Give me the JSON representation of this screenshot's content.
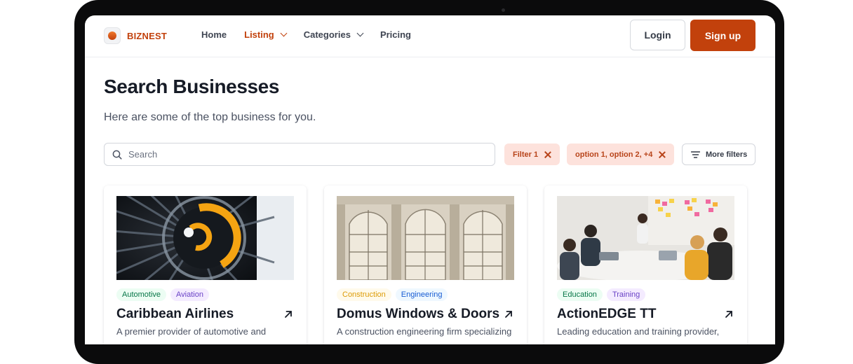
{
  "brand": {
    "name": "BIZNEST"
  },
  "nav": {
    "items": [
      {
        "label": "Home",
        "active": false,
        "dropdown": false
      },
      {
        "label": "Listing",
        "active": true,
        "dropdown": true
      },
      {
        "label": "Categories",
        "active": false,
        "dropdown": true
      },
      {
        "label": "Pricing",
        "active": false,
        "dropdown": false
      }
    ],
    "login_label": "Login",
    "signup_label": "Sign up"
  },
  "page": {
    "title": "Search Businesses",
    "subtitle": "Here are some of the top business for you."
  },
  "search": {
    "placeholder": "Search",
    "value": ""
  },
  "filters": {
    "chips": [
      "Filter 1",
      "option 1, option 2, +4"
    ],
    "more_label": "More filters"
  },
  "cards": [
    {
      "tags": [
        {
          "label": "Automotive",
          "color": "#067647",
          "bg": "#ecfdf3"
        },
        {
          "label": "Aviation",
          "color": "#6941c6",
          "bg": "#f4ebff"
        }
      ],
      "title": "Caribbean Airlines",
      "description": "A premier provider of automotive and",
      "image": "jet-engine-image"
    },
    {
      "tags": [
        {
          "label": "Construction",
          "color": "#dc9b06",
          "bg": "#fffaeb"
        },
        {
          "label": "Engineering",
          "color": "#175cd3",
          "bg": "#eff8ff"
        }
      ],
      "title": "Domus Windows & Doors",
      "description": "A construction engineering firm specializing",
      "image": "building-windows-image"
    },
    {
      "tags": [
        {
          "label": "Education",
          "color": "#067647",
          "bg": "#ecfdf3"
        },
        {
          "label": "Training",
          "color": "#6941c6",
          "bg": "#f4ebff"
        }
      ],
      "title": "ActionEDGE TT",
      "description": "Leading education and training provider,",
      "image": "meeting-room-image"
    }
  ],
  "colors": {
    "accent": "#c2410c",
    "chip_bg": "#fde2dc",
    "text_dark": "#161b26"
  }
}
